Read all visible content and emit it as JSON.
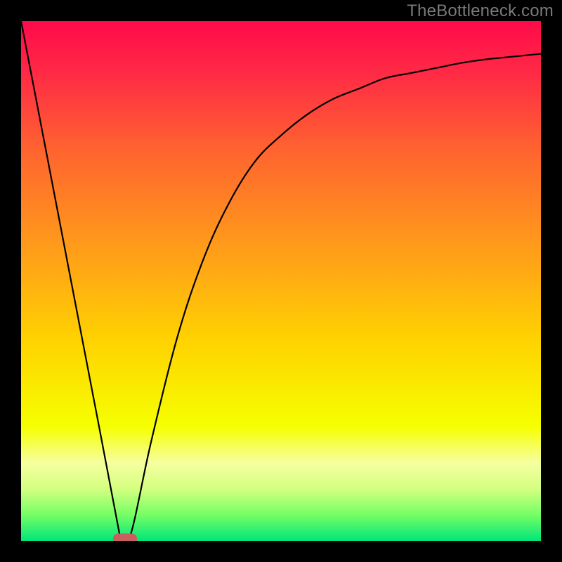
{
  "watermark": "TheBottleneck.com",
  "chart_data": {
    "type": "line",
    "title": "",
    "xlabel": "",
    "ylabel": "",
    "xlim": [
      0,
      100
    ],
    "ylim": [
      0,
      100
    ],
    "series": [
      {
        "name": "bottleneck-curve",
        "x": [
          0,
          5,
          10,
          15,
          19,
          21,
          25,
          30,
          35,
          40,
          45,
          50,
          55,
          60,
          65,
          70,
          75,
          80,
          85,
          90,
          95,
          100
        ],
        "values": [
          100,
          74,
          48,
          22,
          1,
          1,
          19,
          39,
          54,
          65,
          73,
          78,
          82,
          85,
          87,
          89,
          90,
          91,
          92,
          92.7,
          93.2,
          93.7
        ]
      }
    ],
    "marker": {
      "x": 20,
      "y": 0,
      "color": "#c9605f"
    },
    "background_gradient": {
      "type": "vertical",
      "stops": [
        {
          "pos": 0.0,
          "color": "#ff0a4a"
        },
        {
          "pos": 0.1,
          "color": "#ff2a45"
        },
        {
          "pos": 0.25,
          "color": "#ff642f"
        },
        {
          "pos": 0.45,
          "color": "#ffa018"
        },
        {
          "pos": 0.62,
          "color": "#ffd400"
        },
        {
          "pos": 0.78,
          "color": "#f6ff00"
        },
        {
          "pos": 0.85,
          "color": "#f6ffa0"
        },
        {
          "pos": 0.9,
          "color": "#d4ff80"
        },
        {
          "pos": 0.95,
          "color": "#75ff64"
        },
        {
          "pos": 1.0,
          "color": "#00e57a"
        }
      ]
    }
  }
}
